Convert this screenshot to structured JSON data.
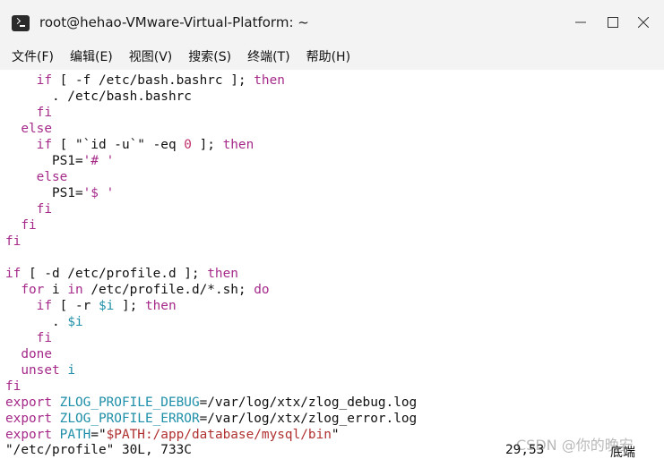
{
  "window": {
    "title": "root@hehao-VMware-Virtual-Platform: ~"
  },
  "menu": [
    "文件(F)",
    "编辑(E)",
    "视图(V)",
    "搜索(S)",
    "终端(T)",
    "帮助(H)"
  ],
  "lines": [
    [
      [
        "    ",
        ""
      ],
      [
        "if",
        "kw"
      ],
      [
        " [ -f /etc/bash.bashrc ]; ",
        ""
      ],
      [
        "then",
        "kw"
      ]
    ],
    [
      [
        "      . /etc/bash.bashrc",
        ""
      ]
    ],
    [
      [
        "    ",
        ""
      ],
      [
        "fi",
        "kw"
      ]
    ],
    [
      [
        "  ",
        ""
      ],
      [
        "else",
        "kw"
      ]
    ],
    [
      [
        "    ",
        ""
      ],
      [
        "if",
        "kw"
      ],
      [
        " [ \"`id -u`\" -eq ",
        ""
      ],
      [
        "0",
        "num"
      ],
      [
        " ]; ",
        ""
      ],
      [
        "then",
        "kw"
      ]
    ],
    [
      [
        "      PS1=",
        ""
      ],
      [
        "'# '",
        "str"
      ]
    ],
    [
      [
        "    ",
        ""
      ],
      [
        "else",
        "kw"
      ]
    ],
    [
      [
        "      PS1=",
        ""
      ],
      [
        "'$ '",
        "str"
      ]
    ],
    [
      [
        "    ",
        ""
      ],
      [
        "fi",
        "kw"
      ]
    ],
    [
      [
        "  ",
        ""
      ],
      [
        "fi",
        "kw"
      ]
    ],
    [
      [
        "fi",
        "kw"
      ]
    ],
    [
      [
        "",
        ""
      ]
    ],
    [
      [
        "if",
        "kw"
      ],
      [
        " [ -d /etc/profile.d ]; ",
        ""
      ],
      [
        "then",
        "kw"
      ]
    ],
    [
      [
        "  ",
        ""
      ],
      [
        "for",
        "kw"
      ],
      [
        " i ",
        ""
      ],
      [
        "in",
        "kw"
      ],
      [
        " /etc/profile.d/*.sh; ",
        ""
      ],
      [
        "do",
        "kw"
      ]
    ],
    [
      [
        "    ",
        ""
      ],
      [
        "if",
        "kw"
      ],
      [
        " [ -r ",
        ""
      ],
      [
        "$i",
        "var"
      ],
      [
        " ]; ",
        ""
      ],
      [
        "then",
        "kw"
      ]
    ],
    [
      [
        "      . ",
        ""
      ],
      [
        "$i",
        "var"
      ]
    ],
    [
      [
        "    ",
        ""
      ],
      [
        "fi",
        "kw"
      ]
    ],
    [
      [
        "  ",
        ""
      ],
      [
        "done",
        "kw"
      ]
    ],
    [
      [
        "  ",
        ""
      ],
      [
        "unset",
        "kw"
      ],
      [
        " ",
        ""
      ],
      [
        "i",
        "var"
      ]
    ],
    [
      [
        "fi",
        "kw"
      ]
    ],
    [
      [
        "export",
        "kw"
      ],
      [
        " ",
        ""
      ],
      [
        "ZLOG_PROFILE_DEBUG",
        "var"
      ],
      [
        "=/var/log/xtx/zlog_debug.log",
        ""
      ]
    ],
    [
      [
        "export",
        "kw"
      ],
      [
        " ",
        ""
      ],
      [
        "ZLOG_PROFILE_ERROR",
        "var"
      ],
      [
        "=/var/log/xtx/zlog_error.log",
        ""
      ]
    ],
    [
      [
        "export",
        "kw"
      ],
      [
        " ",
        ""
      ],
      [
        "PATH",
        "var"
      ],
      [
        "=\"",
        ""
      ],
      [
        "$PATH",
        "red"
      ],
      [
        ":/app/database/mysql/bin",
        "red"
      ],
      [
        "\"",
        ""
      ]
    ]
  ],
  "status": {
    "file": "\"/etc/profile\" 30L, 733C",
    "position": "29,53",
    "scroll": "底端"
  },
  "watermark": "CSDN @你的晚安"
}
